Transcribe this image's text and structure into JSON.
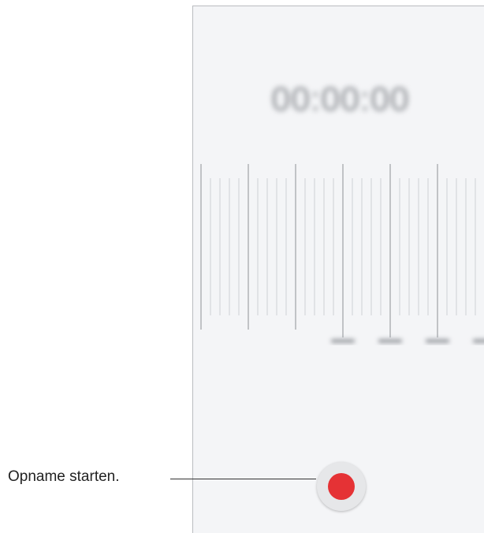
{
  "recorder": {
    "timer": "00:00:00",
    "record_button_label": ""
  },
  "callout": {
    "label": "Opname starten."
  },
  "colors": {
    "background": "#f4f5f7",
    "record_accent": "#e53235",
    "record_button_bg": "#e6e7e9",
    "waveform_lines": "#9a9da2"
  },
  "icons": {
    "record": "record-icon"
  }
}
